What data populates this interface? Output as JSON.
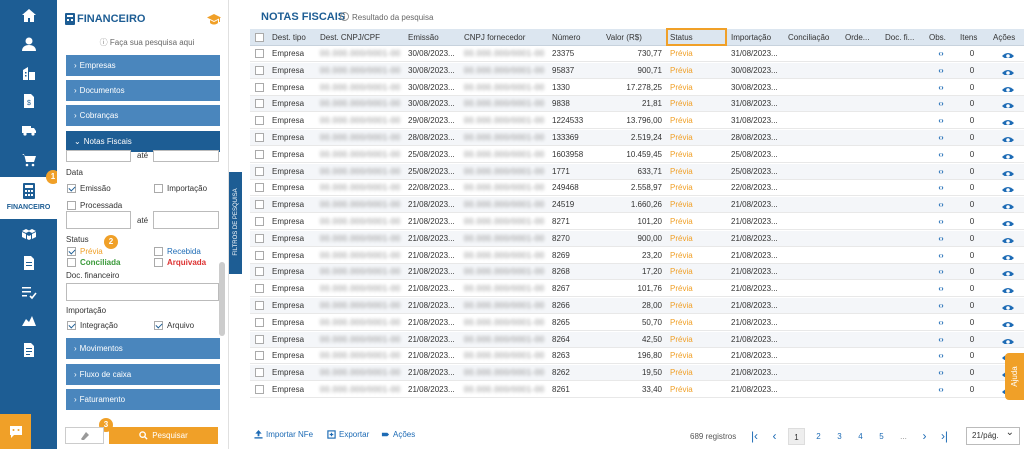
{
  "rail": {
    "active_label": "FINANCEIRO",
    "icons": [
      "home-icon",
      "user-icon",
      "building-icon",
      "invoice-icon",
      "truck-icon",
      "cart-icon",
      "calculator-icon",
      "boxes-icon",
      "document-icon",
      "checklist-icon",
      "chart-icon",
      "file-icon"
    ]
  },
  "panel": {
    "title": "FINANCEIRO",
    "search_tip": "Faça sua pesquisa aqui",
    "sections_top": [
      "Empresas",
      "Documentos",
      "Cobranças"
    ],
    "section_open": "Notas Fiscais",
    "sections_bottom": [
      "Movimentos",
      "Fluxo de caixa",
      "Faturamento"
    ],
    "ate": "até",
    "data_label": "Data",
    "emissao": "Emissão",
    "importacao": "Importação",
    "processada": "Processada",
    "status_label": "Status",
    "status_previa": "Prévia",
    "status_recebida": "Recebida",
    "status_conciliada": "Conciliada",
    "status_arquivada": "Arquivada",
    "doc_financeiro": "Doc. financeiro",
    "importacao_label": "Importação",
    "integracao": "Integração",
    "arquivo": "Arquivo",
    "search_button": "Pesquisar",
    "filter_tab": "FILTROS DE PESQUISA",
    "badges": [
      "1",
      "2",
      "3"
    ]
  },
  "main": {
    "title": "NOTAS FISCAIS",
    "subtitle": "Resultado da pesquisa",
    "headers": [
      "Dest. tipo",
      "Dest. CNPJ/CPF",
      "Emissão",
      "CNPJ fornecedor",
      "Número",
      "Valor (R$)",
      "Status",
      "Importação",
      "Conciliação",
      "Orde...",
      "Doc. fi...",
      "Obs.",
      "Itens",
      "Ações"
    ],
    "rows": [
      {
        "tipo": "Empresa",
        "cnpj": "00.000.000/0001-00",
        "emissao": "30/08/2023...",
        "forn": "00.000.000/0001-00",
        "numero": "23375",
        "valor": "730,77",
        "status": "Prévia",
        "importacao": "31/08/2023...",
        "itens": "0"
      },
      {
        "tipo": "Empresa",
        "cnpj": "00.000.000/0001-00",
        "emissao": "30/08/2023...",
        "forn": "00.000.000/0001-00",
        "numero": "95837",
        "valor": "900,71",
        "status": "Prévia",
        "importacao": "30/08/2023...",
        "itens": "0"
      },
      {
        "tipo": "Empresa",
        "cnpj": "00.000.000/0001-00",
        "emissao": "30/08/2023...",
        "forn": "00.000.000/0001-00",
        "numero": "1330",
        "valor": "17.278,25",
        "status": "Prévia",
        "importacao": "30/08/2023...",
        "itens": "0"
      },
      {
        "tipo": "Empresa",
        "cnpj": "00.000.000/0001-00",
        "emissao": "30/08/2023...",
        "forn": "00.000.000/0001-00",
        "numero": "9838",
        "valor": "21,81",
        "status": "Prévia",
        "importacao": "31/08/2023...",
        "itens": "0"
      },
      {
        "tipo": "Empresa",
        "cnpj": "00.000.000/0001-00",
        "emissao": "29/08/2023...",
        "forn": "00.000.000/0001-00",
        "numero": "1224533",
        "valor": "13.796,00",
        "status": "Prévia",
        "importacao": "31/08/2023...",
        "itens": "0"
      },
      {
        "tipo": "Empresa",
        "cnpj": "00.000.000/0001-00",
        "emissao": "28/08/2023...",
        "forn": "00.000.000/0001-00",
        "numero": "133369",
        "valor": "2.519,24",
        "status": "Prévia",
        "importacao": "28/08/2023...",
        "itens": "0"
      },
      {
        "tipo": "Empresa",
        "cnpj": "00.000.000/0001-00",
        "emissao": "25/08/2023...",
        "forn": "00.000.000/0001-00",
        "numero": "1603958",
        "valor": "10.459,45",
        "status": "Prévia",
        "importacao": "25/08/2023...",
        "itens": "0"
      },
      {
        "tipo": "Empresa",
        "cnpj": "00.000.000/0001-00",
        "emissao": "25/08/2023...",
        "forn": "00.000.000/0001-00",
        "numero": "1771",
        "valor": "633,71",
        "status": "Prévia",
        "importacao": "25/08/2023...",
        "itens": "0"
      },
      {
        "tipo": "Empresa",
        "cnpj": "00.000.000/0001-00",
        "emissao": "22/08/2023...",
        "forn": "00.000.000/0001-00",
        "numero": "249468",
        "valor": "2.558,97",
        "status": "Prévia",
        "importacao": "22/08/2023...",
        "itens": "0"
      },
      {
        "tipo": "Empresa",
        "cnpj": "00.000.000/0001-00",
        "emissao": "21/08/2023...",
        "forn": "00.000.000/0001-00",
        "numero": "24519",
        "valor": "1.660,26",
        "status": "Prévia",
        "importacao": "21/08/2023...",
        "itens": "0"
      },
      {
        "tipo": "Empresa",
        "cnpj": "00.000.000/0001-00",
        "emissao": "21/08/2023...",
        "forn": "00.000.000/0001-00",
        "numero": "8271",
        "valor": "101,20",
        "status": "Prévia",
        "importacao": "21/08/2023...",
        "itens": "0"
      },
      {
        "tipo": "Empresa",
        "cnpj": "00.000.000/0001-00",
        "emissao": "21/08/2023...",
        "forn": "00.000.000/0001-00",
        "numero": "8270",
        "valor": "900,00",
        "status": "Prévia",
        "importacao": "21/08/2023...",
        "itens": "0"
      },
      {
        "tipo": "Empresa",
        "cnpj": "00.000.000/0001-00",
        "emissao": "21/08/2023...",
        "forn": "00.000.000/0001-00",
        "numero": "8269",
        "valor": "23,20",
        "status": "Prévia",
        "importacao": "21/08/2023...",
        "itens": "0"
      },
      {
        "tipo": "Empresa",
        "cnpj": "00.000.000/0001-00",
        "emissao": "21/08/2023...",
        "forn": "00.000.000/0001-00",
        "numero": "8268",
        "valor": "17,20",
        "status": "Prévia",
        "importacao": "21/08/2023...",
        "itens": "0"
      },
      {
        "tipo": "Empresa",
        "cnpj": "00.000.000/0001-00",
        "emissao": "21/08/2023...",
        "forn": "00.000.000/0001-00",
        "numero": "8267",
        "valor": "101,76",
        "status": "Prévia",
        "importacao": "21/08/2023...",
        "itens": "0"
      },
      {
        "tipo": "Empresa",
        "cnpj": "00.000.000/0001-00",
        "emissao": "21/08/2023...",
        "forn": "00.000.000/0001-00",
        "numero": "8266",
        "valor": "28,00",
        "status": "Prévia",
        "importacao": "21/08/2023...",
        "itens": "0"
      },
      {
        "tipo": "Empresa",
        "cnpj": "00.000.000/0001-00",
        "emissao": "21/08/2023...",
        "forn": "00.000.000/0001-00",
        "numero": "8265",
        "valor": "50,70",
        "status": "Prévia",
        "importacao": "21/08/2023...",
        "itens": "0"
      },
      {
        "tipo": "Empresa",
        "cnpj": "00.000.000/0001-00",
        "emissao": "21/08/2023...",
        "forn": "00.000.000/0001-00",
        "numero": "8264",
        "valor": "42,50",
        "status": "Prévia",
        "importacao": "21/08/2023...",
        "itens": "0"
      },
      {
        "tipo": "Empresa",
        "cnpj": "00.000.000/0001-00",
        "emissao": "21/08/2023...",
        "forn": "00.000.000/0001-00",
        "numero": "8263",
        "valor": "196,80",
        "status": "Prévia",
        "importacao": "21/08/2023...",
        "itens": "0"
      },
      {
        "tipo": "Empresa",
        "cnpj": "00.000.000/0001-00",
        "emissao": "21/08/2023...",
        "forn": "00.000.000/0001-00",
        "numero": "8262",
        "valor": "19,50",
        "status": "Prévia",
        "importacao": "21/08/2023...",
        "itens": "0"
      },
      {
        "tipo": "Empresa",
        "cnpj": "00.000.000/0001-00",
        "emissao": "21/08/2023...",
        "forn": "00.000.000/0001-00",
        "numero": "8261",
        "valor": "33,40",
        "status": "Prévia",
        "importacao": "21/08/2023...",
        "itens": "0"
      }
    ],
    "obs_symbol": "‹›",
    "footer": {
      "import": "Importar NFe",
      "export": "Exportar",
      "actions": "Ações",
      "registros": "689 registros",
      "pages": [
        "1",
        "2",
        "3",
        "4",
        "5",
        "..."
      ],
      "per_page": "21/pág."
    },
    "ajuda": "Ajuda"
  }
}
